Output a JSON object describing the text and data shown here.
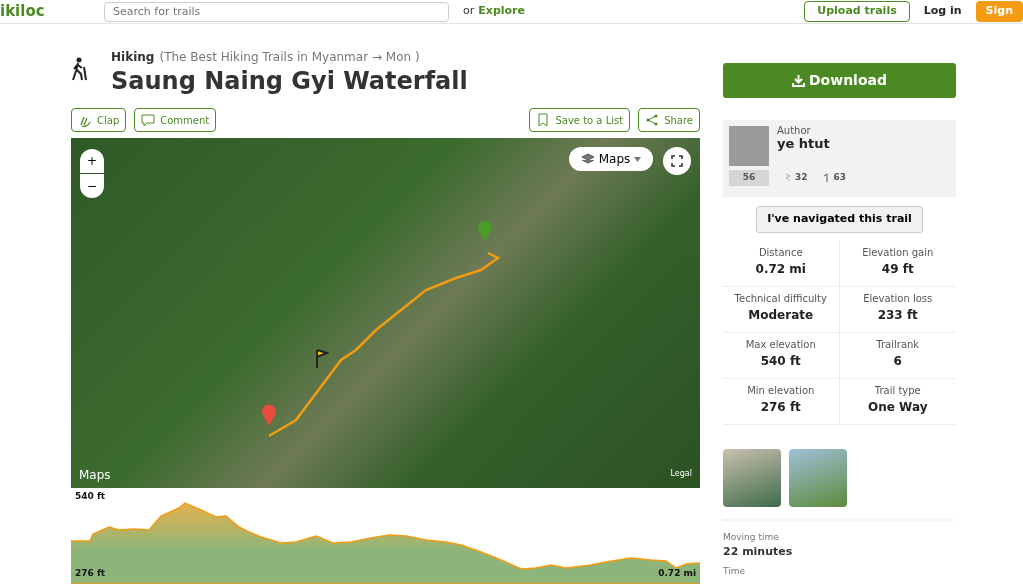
{
  "header": {
    "logo": "ikiloc",
    "search": {
      "placeholder": "Search for trails"
    },
    "or_text": "or",
    "explore": "Explore",
    "upload": "Upload trails",
    "login": "Log in",
    "signup": "Sign"
  },
  "trail": {
    "activity": "Hiking",
    "breadcrumb": "(The Best Hiking Trails in Myanmar → Mon )",
    "title": "Saung Naing Gyi Waterfall"
  },
  "actions_left": [
    {
      "kind": "clap",
      "label": "Clap"
    },
    {
      "kind": "comment",
      "label": "Comment"
    }
  ],
  "actions_right": [
    {
      "kind": "save",
      "label": "Save to a List"
    },
    {
      "kind": "share",
      "label": "Share"
    }
  ],
  "map": {
    "zoom_in": "+",
    "zoom_out": "−",
    "layer": "Maps",
    "brand": "Maps",
    "legal": "Legal"
  },
  "profile": {
    "max": "540 ft",
    "min": "276 ft",
    "distance": "0.72 mi"
  },
  "download": "Download",
  "author": {
    "caption": "Author",
    "name": "ye htut",
    "rank": "56",
    "followers": "32",
    "trails": "63"
  },
  "navigated": "I've navigated this trail",
  "stats": [
    {
      "label": "Distance",
      "value": "0.72 mi"
    },
    {
      "label": "Elevation gain",
      "value": "49 ft"
    },
    {
      "label": "Technical difficulty",
      "value": "Moderate"
    },
    {
      "label": "Elevation loss",
      "value": "233 ft"
    },
    {
      "label": "Max elevation",
      "value": "540 ft"
    },
    {
      "label": "Trailrank",
      "value": "6"
    },
    {
      "label": "Min elevation",
      "value": "276 ft"
    },
    {
      "label": "Trail type",
      "value": "One Way"
    }
  ],
  "details": [
    {
      "label": "Moving time",
      "value": "22 minutes"
    },
    {
      "label": "Time"
    }
  ]
}
